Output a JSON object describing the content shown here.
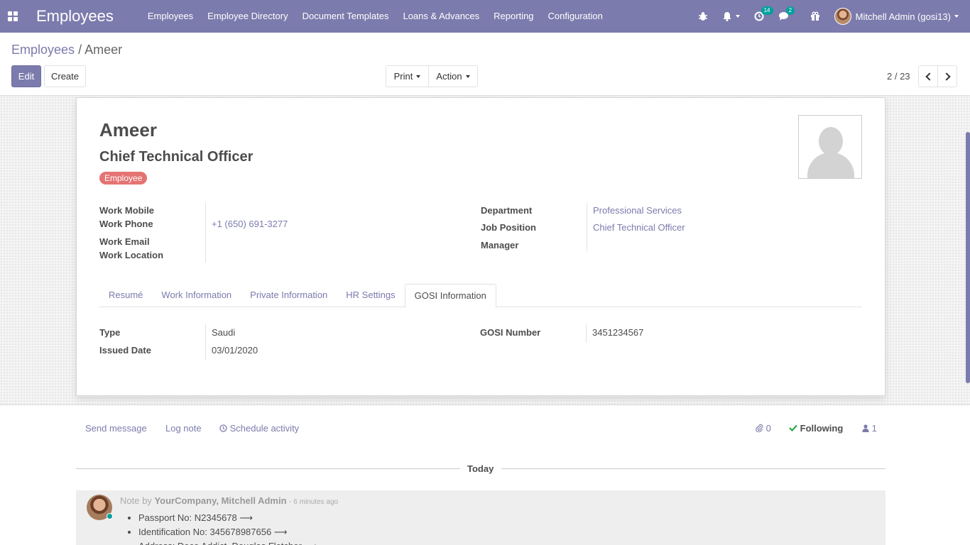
{
  "navbar": {
    "app_title": "Employees",
    "menu": [
      "Employees",
      "Employee Directory",
      "Document Templates",
      "Loans & Advances",
      "Reporting",
      "Configuration"
    ],
    "activity_count": "14",
    "message_count": "2",
    "user": "Mitchell Admin (gosi13)"
  },
  "breadcrumb": {
    "parent": "Employees",
    "separator": "/",
    "current": "Ameer"
  },
  "buttons": {
    "edit": "Edit",
    "create": "Create",
    "print": "Print",
    "action": "Action"
  },
  "pager": {
    "value": "2 / 23"
  },
  "employee": {
    "name": "Ameer",
    "job_title": "Chief Technical Officer",
    "tag": "Employee"
  },
  "fields_left": {
    "work_mobile_label": "Work Mobile",
    "work_phone_label": "Work Phone",
    "work_phone": "+1 (650) 691-3277",
    "work_email_label": "Work Email",
    "work_location_label": "Work Location"
  },
  "fields_right": {
    "department_label": "Department",
    "department": "Professional Services",
    "job_position_label": "Job Position",
    "job_position": "Chief Technical Officer",
    "manager_label": "Manager"
  },
  "tabs": [
    "Resumé",
    "Work Information",
    "Private Information",
    "HR Settings",
    "GOSI Information"
  ],
  "active_tab": "GOSI Information",
  "gosi": {
    "type_label": "Type",
    "type": "Saudi",
    "issued_date_label": "Issued Date",
    "issued_date": "03/01/2020",
    "gosi_number_label": "GOSI Number",
    "gosi_number": "3451234567"
  },
  "chatter": {
    "send_message": "Send message",
    "log_note": "Log note",
    "schedule_activity": "Schedule activity",
    "attachments": "0",
    "following": "Following",
    "followers": "1",
    "today": "Today"
  },
  "message": {
    "prefix": "Note by",
    "author": "YourCompany, Mitchell Admin",
    "time": "- 6 minutes ago",
    "items": [
      "Passport No: N2345678 ⟶",
      "Identification No: 345678987656 ⟶",
      "Address: Deco Addict, Douglas Fletcher ⟶"
    ]
  },
  "colors": {
    "brand": "#7c7bad",
    "tag": "#e57373",
    "badge": "#00a09d",
    "following_check": "#28a745"
  }
}
